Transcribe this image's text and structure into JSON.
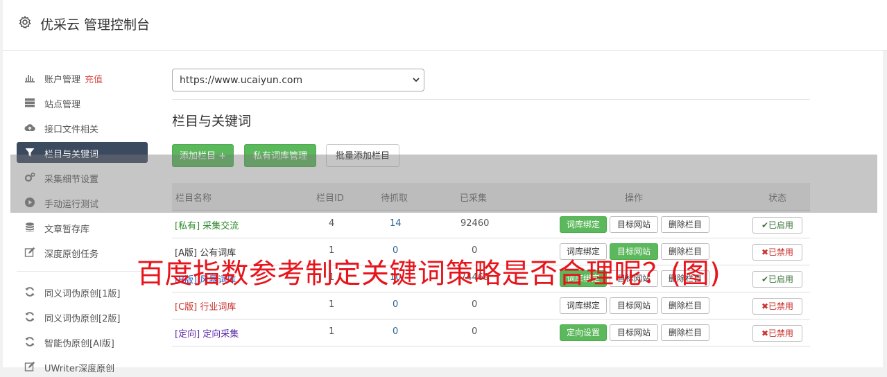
{
  "header": {
    "title": "优采云 管理控制台"
  },
  "sidebar": {
    "items": [
      {
        "label": "账户管理",
        "extra": "充值",
        "icon": "bar-chart-icon"
      },
      {
        "label": "站点管理",
        "icon": "server-icon"
      },
      {
        "label": "接口文件相关",
        "icon": "cloud-upload-icon"
      },
      {
        "label": "栏目与关键词",
        "icon": "filter-icon",
        "active": true
      },
      {
        "label": "采集细节设置",
        "icon": "cogs-icon"
      },
      {
        "label": "手动运行测试",
        "icon": "play-circle-icon"
      },
      {
        "label": "文章暂存库",
        "icon": "database-icon"
      },
      {
        "label": "深度原创任务",
        "icon": "edit-icon"
      },
      {
        "label": "同义词伪原创[1版]",
        "icon": "refresh-icon"
      },
      {
        "label": "同义词伪原创[2版]",
        "icon": "refresh-icon"
      },
      {
        "label": "智能伪原创[AI版]",
        "icon": "refresh-icon"
      },
      {
        "label": "UWriter深度原创",
        "icon": "edit-icon"
      }
    ]
  },
  "site_select": {
    "value": "https://www.ucaiyun.com"
  },
  "section": {
    "title": "栏目与关键词"
  },
  "toolbar": {
    "add_column": "添加栏目 +",
    "private_lexicon": "私有词库管理",
    "batch_add": "批量添加栏目"
  },
  "table": {
    "headers": {
      "name": "栏目名称",
      "id": "栏目ID",
      "pending": "待抓取",
      "collected": "已采集",
      "actions": "操作",
      "status": "状态"
    },
    "rows": [
      {
        "tag": "[私有]",
        "name": "采集交流",
        "id": "4",
        "pending": "14",
        "collected": "92460",
        "btn1": "词库绑定",
        "btn1_green": true,
        "btn2": "目标网站",
        "btn2_green": false,
        "btn3": "删除栏目",
        "status": "已启用",
        "on": true
      },
      {
        "tag": "[A版]",
        "name": "公有词库",
        "id": "1",
        "pending": "0",
        "collected": "0",
        "btn1": "词库绑定",
        "btn1_green": false,
        "btn2": "目标网站",
        "btn2_green": true,
        "btn3": "删除栏目",
        "status": "已禁用",
        "on": false
      },
      {
        "tag": "[B版]",
        "name": "风暴词库",
        "id": "1",
        "pending": "10",
        "collected": "74469",
        "btn1": "词库绑定",
        "btn1_green": true,
        "btn2": "目标网站",
        "btn2_green": false,
        "btn3": "删除栏目",
        "status": "已启用",
        "on": true
      },
      {
        "tag": "[C版]",
        "name": "行业词库",
        "id": "1",
        "pending": "0",
        "collected": "0",
        "btn1": "词库绑定",
        "btn1_green": false,
        "btn2": "目标网站",
        "btn2_green": false,
        "btn3": "删除栏目",
        "status": "已禁用",
        "on": false
      },
      {
        "tag": "[定向]",
        "name": "定向采集",
        "id": "1",
        "pending": "0",
        "collected": "0",
        "btn1": "定向设置",
        "btn1_green": true,
        "btn2": "目标网站",
        "btn2_green": false,
        "btn3": "删除栏目",
        "status": "已禁用",
        "on": false
      }
    ]
  },
  "overlay": {
    "headline": "百度指数参考制定关键词策略是否合理呢？(图)"
  }
}
